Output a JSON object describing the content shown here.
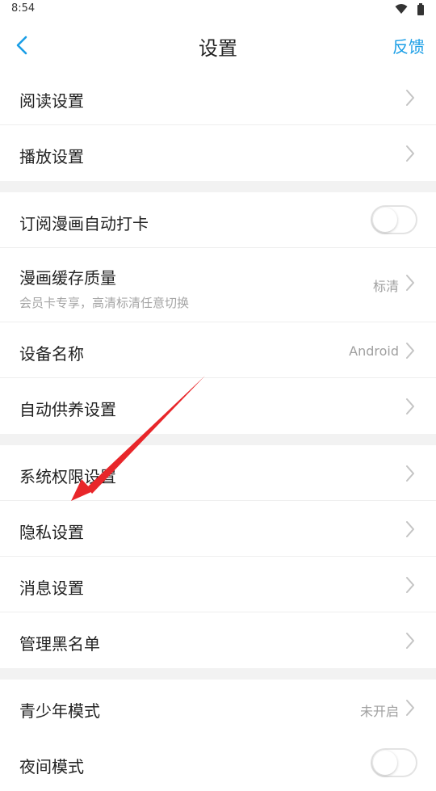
{
  "status_bar": {
    "time": "8:54",
    "icons": [
      "wifi-icon",
      "battery-icon"
    ]
  },
  "header": {
    "back_icon": "chevron-left-icon",
    "title": "设置",
    "feedback_label": "反馈"
  },
  "colors": {
    "accent": "#1a9ee6",
    "annotation_arrow": "#e8262a",
    "section_gap": "#f2f2f2"
  },
  "sections": [
    {
      "items": [
        {
          "label": "阅读设置"
        },
        {
          "label": "播放设置"
        }
      ]
    },
    {
      "items": [
        {
          "label": "订阅漫画自动打卡",
          "toggle_on": false
        },
        {
          "label": "漫画缓存质量",
          "subtitle": "会员卡专享，高清标清任意切换",
          "value": "标清"
        },
        {
          "label": "设备名称",
          "value": "Android"
        },
        {
          "label": "自动供养设置"
        }
      ]
    },
    {
      "items": [
        {
          "label": "系统权限设置"
        },
        {
          "label": "隐私设置"
        },
        {
          "label": "消息设置"
        },
        {
          "label": "管理黑名单"
        }
      ]
    },
    {
      "items": [
        {
          "label": "青少年模式",
          "value": "未开启"
        },
        {
          "label": "夜间模式",
          "toggle_on": false
        }
      ]
    }
  ]
}
